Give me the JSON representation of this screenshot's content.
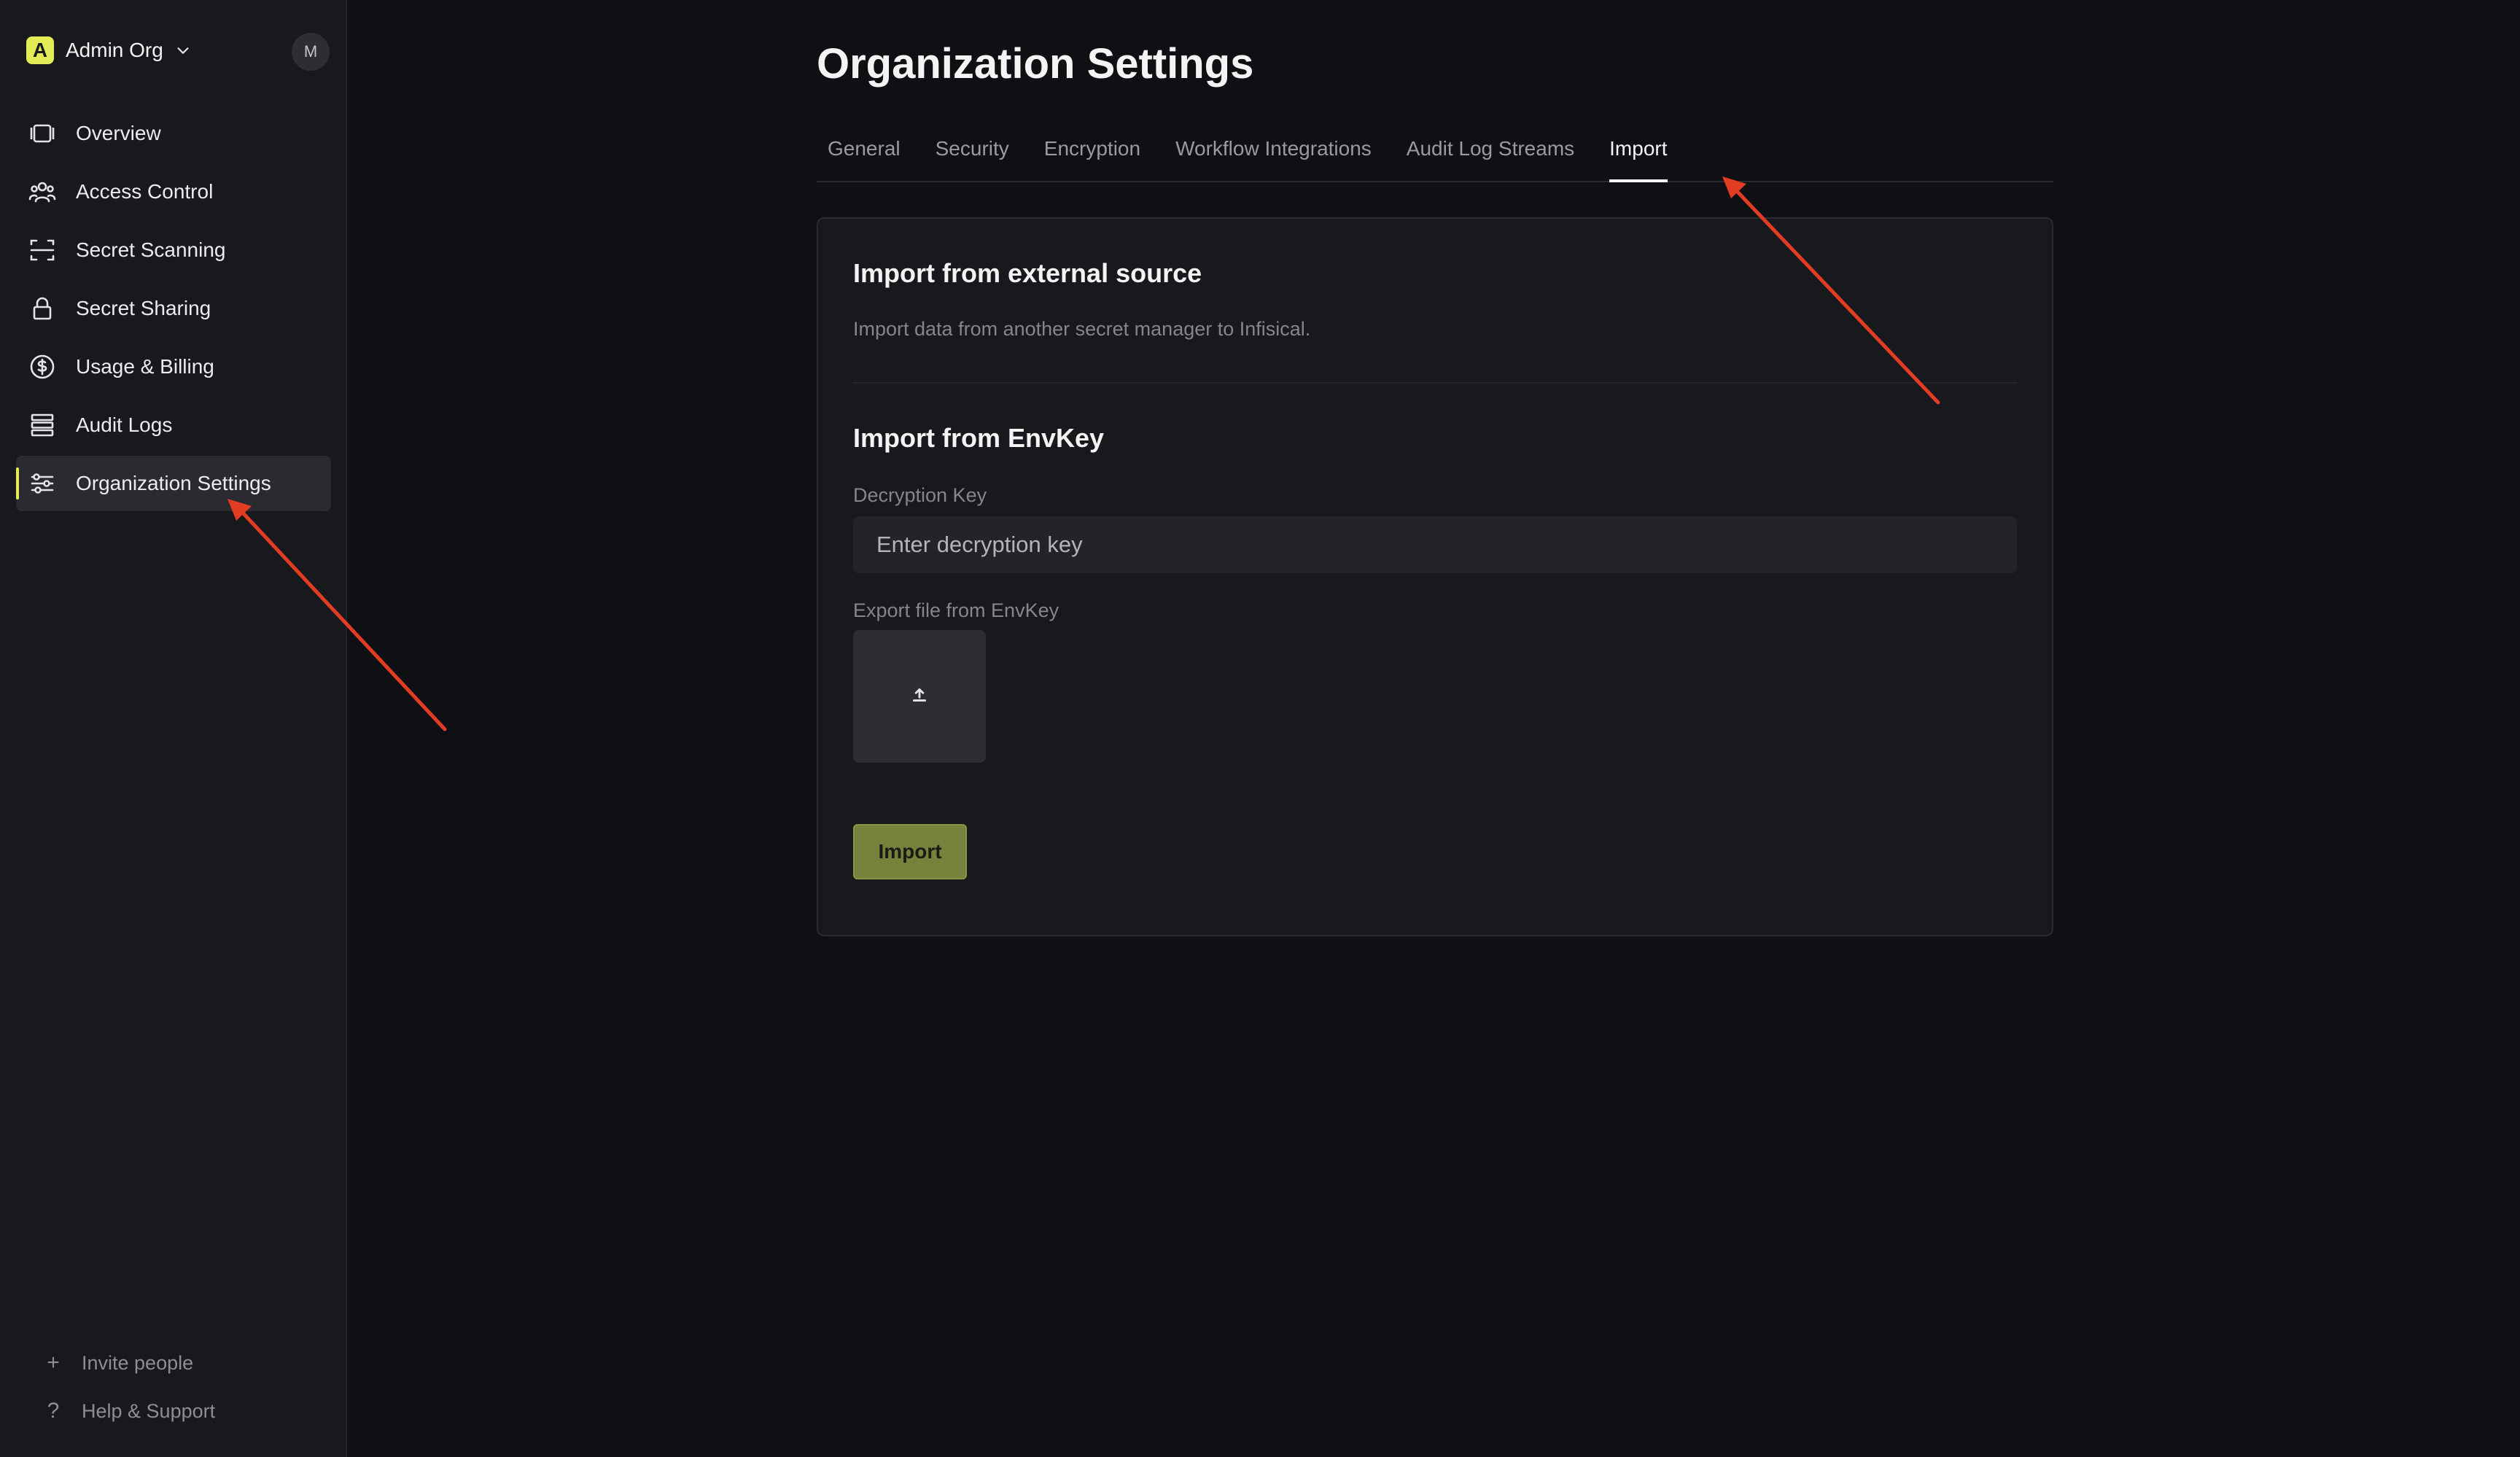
{
  "sidebar": {
    "org_badge": "A",
    "org_name": "Admin Org",
    "avatar_initial": "M",
    "items": [
      {
        "label": "Overview",
        "icon": "overview-icon"
      },
      {
        "label": "Access Control",
        "icon": "users-icon"
      },
      {
        "label": "Secret Scanning",
        "icon": "scan-icon"
      },
      {
        "label": "Secret Sharing",
        "icon": "lock-icon"
      },
      {
        "label": "Usage & Billing",
        "icon": "dollar-icon"
      },
      {
        "label": "Audit Logs",
        "icon": "list-icon"
      },
      {
        "label": "Organization Settings",
        "icon": "sliders-icon",
        "active": true
      }
    ],
    "footer": {
      "invite_label": "Invite people",
      "help_label": "Help & Support"
    }
  },
  "main": {
    "title": "Organization Settings",
    "tabs": [
      {
        "label": "General"
      },
      {
        "label": "Security"
      },
      {
        "label": "Encryption"
      },
      {
        "label": "Workflow Integrations"
      },
      {
        "label": "Audit Log Streams"
      },
      {
        "label": "Import",
        "active": true
      }
    ],
    "card": {
      "external_title": "Import from external source",
      "external_desc": "Import data from another secret manager to Infisical.",
      "envkey_title": "Import from EnvKey",
      "decryption_label": "Decryption Key",
      "decryption_placeholder": "Enter decryption key",
      "decryption_value": "",
      "export_label": "Export file from EnvKey",
      "import_button": "Import"
    }
  },
  "colors": {
    "background": "#0f1013",
    "sidebar": "#18191c",
    "accent": "#e3ec57",
    "import_button": "#78813b",
    "annotation_arrow": "#e23c22"
  }
}
